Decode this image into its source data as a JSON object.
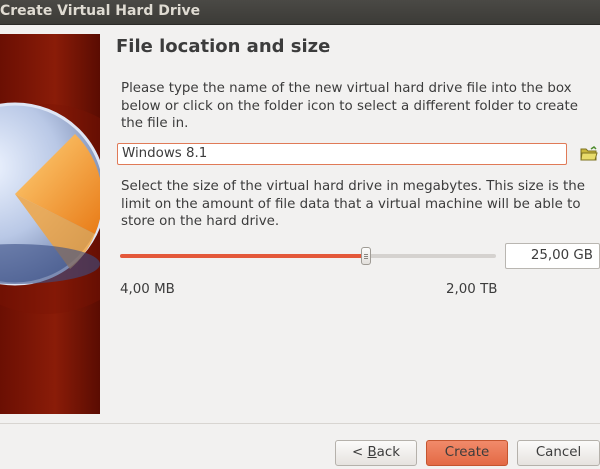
{
  "window": {
    "title": "Create Virtual Hard Drive"
  },
  "page": {
    "heading": "File location and size",
    "location_text": "Please type the name of the new virtual hard drive file into the box below or click on the folder icon to select a different folder to create the file in.",
    "file_name": "Windows 8.1",
    "size_text": "Select the size of the virtual hard drive in megabytes. This size is the limit on the amount of file data that a virtual machine will be able to store on the hard drive.",
    "size_value": "25,00 GB",
    "slider_fraction": 0.655,
    "min_label": "4,00 MB",
    "max_label": "2,00 TB"
  },
  "buttons": {
    "back_prefix": "< ",
    "back_mnemonic": "B",
    "back_rest": "ack",
    "create": "Create",
    "cancel": "Cancel"
  },
  "colors": {
    "accent": "#e4583a",
    "field_focus": "#e07a57"
  },
  "icons": {
    "folder": "folder-open-icon",
    "side_art": "hard-drive-art"
  }
}
